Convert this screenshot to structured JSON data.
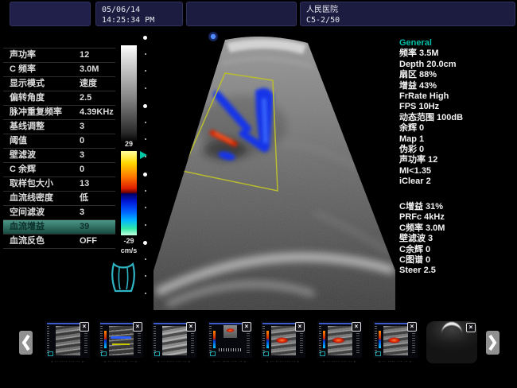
{
  "top_bar": {
    "date": "05/06/14",
    "time": "14:25:34 PM",
    "hospital_name": "人民医院",
    "probe_model": "C5-2/50"
  },
  "left_panel": {
    "rows": [
      {
        "label": "声功率",
        "value": "12"
      },
      {
        "label": "C 频率",
        "value": "3.0M"
      },
      {
        "label": "显示模式",
        "value": "速度"
      },
      {
        "label": "偏转角度",
        "value": "2.5"
      },
      {
        "label": "脉冲重复频率",
        "value": "4.39KHz"
      },
      {
        "label": "基线调整",
        "value": "3"
      },
      {
        "label": "阈值",
        "value": "0"
      },
      {
        "label": "壁滤波",
        "value": "3"
      },
      {
        "label": "C 余辉",
        "value": "0"
      },
      {
        "label": "取样包大小",
        "value": "13"
      },
      {
        "label": "血流线密度",
        "value": "低"
      },
      {
        "label": "空间滤波",
        "value": "3"
      },
      {
        "label": "血流增益",
        "value": "39"
      },
      {
        "label": "血流反色",
        "value": "OFF"
      }
    ],
    "highlighted_row": "血流增益"
  },
  "color_scale": {
    "max": "29",
    "min": "-29",
    "unit": "cm/s"
  },
  "right_panel": {
    "general": {
      "title": "General",
      "lines": [
        "频率 3.5M",
        "Depth 20.0cm",
        "扇区 88%",
        "增益 43%",
        "FrRate High",
        "FPS 10Hz",
        "动态范围 100dB",
        "余辉 0",
        "Map 1",
        "伪彩 0",
        "声功率 12",
        "MI<1.35",
        "iClear 2"
      ]
    },
    "color_mode": {
      "lines": [
        "C增益 31%",
        "PRFc 4kHz",
        "C频率 3.0M",
        "壁滤波 3",
        "C余辉 0",
        "C图谱 0",
        "Steer 2.5"
      ]
    }
  },
  "film_strip": {
    "close_icon": "×",
    "caption_placeholder": "‹ ·· ···· ··· ·· ›",
    "thumbnail_count": 8
  },
  "colors": {
    "accent_teal": "#00bfa8",
    "roi_yellow": "#b9bd2e",
    "doppler_blue": "#1536e8",
    "doppler_red": "#d42300",
    "highlight_row_top": "#4d9889",
    "highlight_row_bottom": "#174a40",
    "topbar_box": "#1c1c40"
  }
}
